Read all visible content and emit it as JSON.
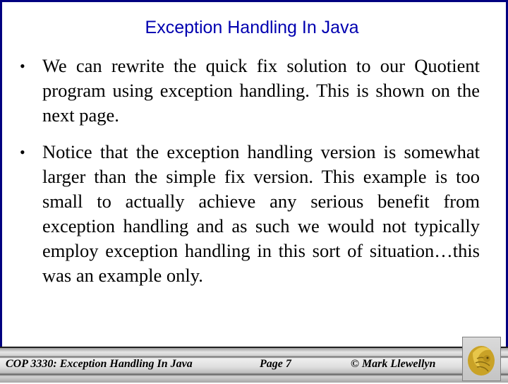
{
  "slide": {
    "title": "Exception Handling In Java",
    "bullets": [
      "We can rewrite the quick fix solution to our Quotient program using exception handling. This is shown on the next page.",
      "Notice that the exception handling version is somewhat larger than the simple fix version. This example is too small to actually achieve any serious benefit from exception handling and as such we would not typically employ exception handling in this sort of situation…this was an example only."
    ],
    "bullet_glyph": "•"
  },
  "footer": {
    "course": "COP 3330:  Exception Handling In Java",
    "page": "Page 7",
    "author": "© Mark Llewellyn",
    "logo_icon": "ucf-pegasus-logo"
  },
  "colors": {
    "title": "#0000b0",
    "frame": "#000080",
    "logo_gold": "#c9a227"
  }
}
